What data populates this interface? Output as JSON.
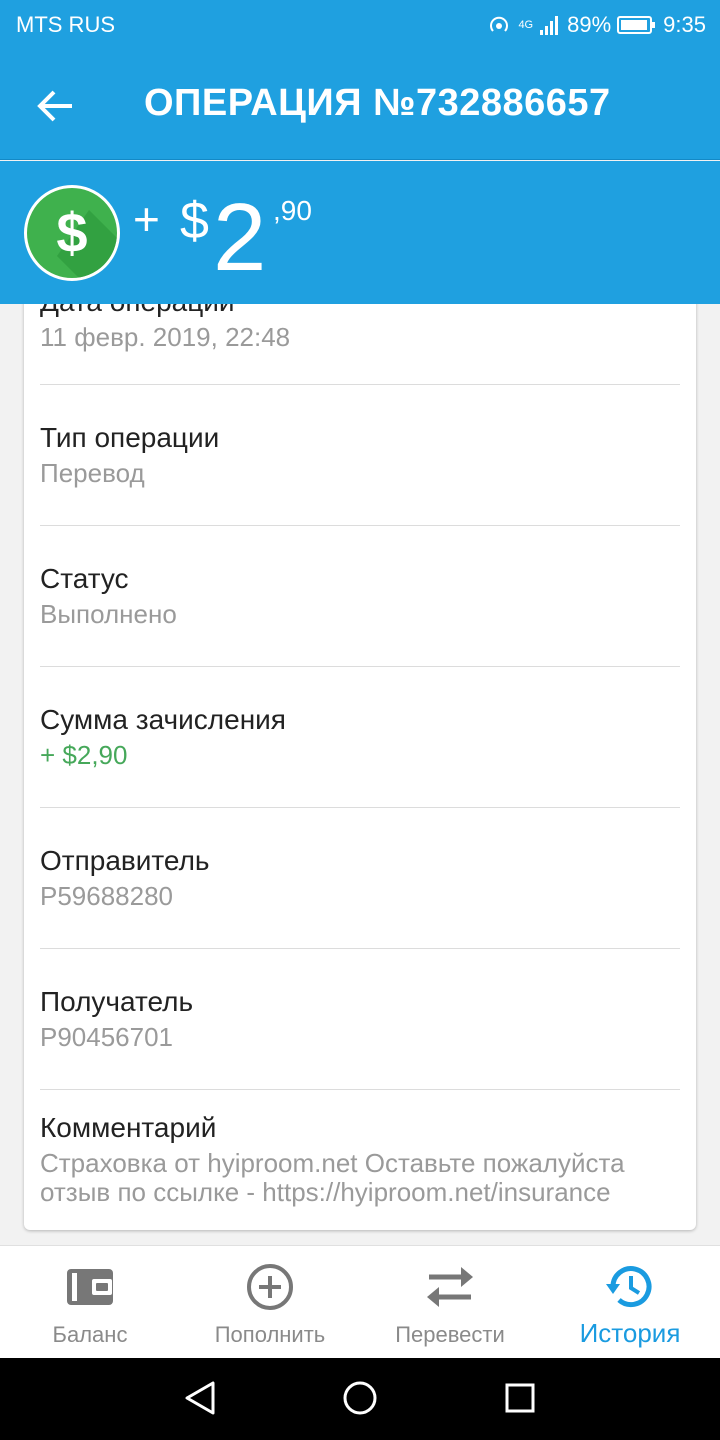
{
  "status_bar": {
    "carrier": "MTS RUS",
    "network": "4G",
    "battery": "89%",
    "time": "9:35"
  },
  "app_bar": {
    "title": "ОПЕРАЦИЯ №732886657",
    "back_icon": "arrow-left-icon"
  },
  "amount": {
    "sign": "+",
    "currency": "$",
    "integer": "2",
    "cents": ",90",
    "icon": "dollar-icon"
  },
  "fields": [
    {
      "label": "Дата операции",
      "value": "11 февр. 2019, 22:48"
    },
    {
      "label": "Тип операции",
      "value": "Перевод"
    },
    {
      "label": "Статус",
      "value": "Выполнено"
    },
    {
      "label": "Сумма зачисления",
      "value": "+ $2,90"
    },
    {
      "label": "Отправитель",
      "value": "P59688280"
    },
    {
      "label": "Получатель",
      "value": "P90456701"
    },
    {
      "label": "Комментарий",
      "value": "Страховка от hyiproom.net  Оставьте пожалуйста отзыв по ссылке - https://hyiproom.net/insurance"
    }
  ],
  "bottom_nav": [
    {
      "label": "Баланс",
      "icon": "wallet-icon",
      "active": false
    },
    {
      "label": "Пополнить",
      "icon": "plus-circle-icon",
      "active": false
    },
    {
      "label": "Перевести",
      "icon": "transfer-arrows-icon",
      "active": false
    },
    {
      "label": "История",
      "icon": "history-icon",
      "active": true
    }
  ],
  "colors": {
    "primary": "#1fa0e0",
    "success": "#46a85a",
    "dollar_badge": "#3fb14d",
    "active_nav": "#1a9be0"
  }
}
